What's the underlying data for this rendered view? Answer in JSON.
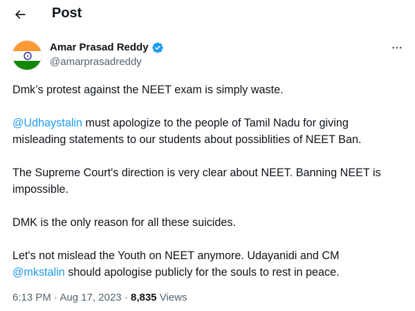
{
  "header": {
    "title": "Post"
  },
  "author": {
    "name": "Amar Prasad Reddy",
    "handle": "@amarprasadreddy"
  },
  "tweet": {
    "p1": "Dmk’s protest against the NEET exam is simply waste.",
    "p2_mention": "@Udhaystalin",
    "p2_line1_rest": " must apologize to the people of Tamil Nadu for giving",
    "p2_line2": "misleading statements to our students about possiblities of NEET Ban.",
    "p3_line1": "The Supreme Court's direction is very clear about NEET. Banning NEET is",
    "p3_line2": "impossible.",
    "p4": "DMK is the only reason for all these suicides.",
    "p5_line1": "Let's not mislead the Youth on NEET anymore. Udayanidi and CM",
    "p5_mention": "@mkstalin",
    "p5_line2_rest": " should apologise publicly for the souls to rest in peace."
  },
  "meta": {
    "time": "6:13 PM",
    "sep1": " · ",
    "date": "Aug 17, 2023",
    "sep2": " · ",
    "views_count": "8,835",
    "views_label": " Views"
  },
  "colors": {
    "link": "#1d9bf0",
    "verified": "#1d9bf0",
    "secondary_text": "#536471",
    "flag_saffron": "#ff9933",
    "flag_white": "#ffffff",
    "flag_green": "#138808",
    "chakra": "#000080"
  },
  "icons": {
    "back": "arrow-left-icon",
    "verified": "verified-badge-icon",
    "more": "more-horizontal-icon"
  }
}
